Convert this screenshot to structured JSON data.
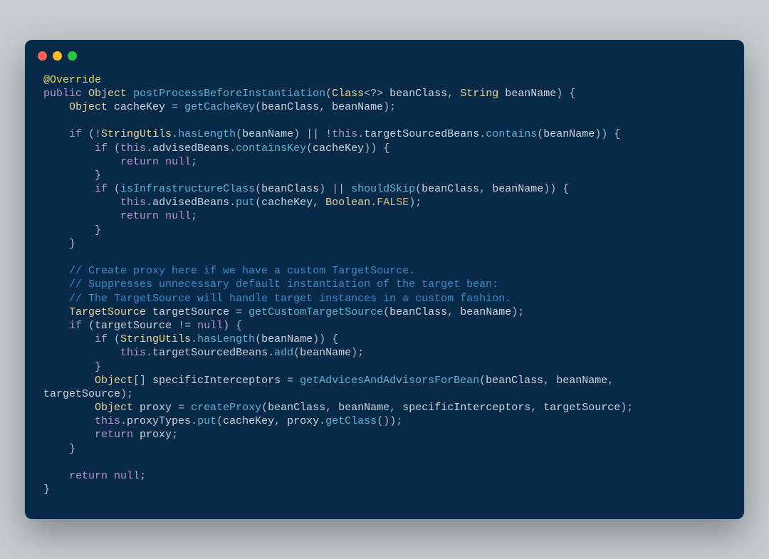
{
  "window": {
    "traffic": {
      "red": "#ff5f56",
      "yellow": "#ffbd2e",
      "green": "#27c93f"
    }
  },
  "code": {
    "lines": [
      [
        {
          "c": "annot",
          "t": "@Override"
        }
      ],
      [
        {
          "c": "keyword",
          "t": "public"
        },
        {
          "c": "punct",
          "t": " "
        },
        {
          "c": "type",
          "t": "Object"
        },
        {
          "c": "punct",
          "t": " "
        },
        {
          "c": "method",
          "t": "postProcessBeforeInstantiation"
        },
        {
          "c": "punct",
          "t": "("
        },
        {
          "c": "type",
          "t": "Class"
        },
        {
          "c": "punct",
          "t": "<?> "
        },
        {
          "c": "ident",
          "t": "beanClass"
        },
        {
          "c": "punct",
          "t": ", "
        },
        {
          "c": "type",
          "t": "String"
        },
        {
          "c": "punct",
          "t": " "
        },
        {
          "c": "ident",
          "t": "beanName"
        },
        {
          "c": "punct",
          "t": ") {"
        }
      ],
      [
        {
          "c": "punct",
          "t": "    "
        },
        {
          "c": "type",
          "t": "Object"
        },
        {
          "c": "punct",
          "t": " "
        },
        {
          "c": "ident",
          "t": "cacheKey"
        },
        {
          "c": "punct",
          "t": " = "
        },
        {
          "c": "method",
          "t": "getCacheKey"
        },
        {
          "c": "punct",
          "t": "("
        },
        {
          "c": "ident",
          "t": "beanClass"
        },
        {
          "c": "punct",
          "t": ", "
        },
        {
          "c": "ident",
          "t": "beanName"
        },
        {
          "c": "punct",
          "t": ");"
        }
      ],
      [
        {
          "c": "punct",
          "t": ""
        }
      ],
      [
        {
          "c": "punct",
          "t": "    "
        },
        {
          "c": "keyword",
          "t": "if"
        },
        {
          "c": "punct",
          "t": " (!"
        },
        {
          "c": "type",
          "t": "StringUtils"
        },
        {
          "c": "punct",
          "t": "."
        },
        {
          "c": "method",
          "t": "hasLength"
        },
        {
          "c": "punct",
          "t": "("
        },
        {
          "c": "ident",
          "t": "beanName"
        },
        {
          "c": "punct",
          "t": ") || !"
        },
        {
          "c": "kwthis",
          "t": "this"
        },
        {
          "c": "punct",
          "t": "."
        },
        {
          "c": "ident",
          "t": "targetSourcedBeans"
        },
        {
          "c": "punct",
          "t": "."
        },
        {
          "c": "method",
          "t": "contains"
        },
        {
          "c": "punct",
          "t": "("
        },
        {
          "c": "ident",
          "t": "beanName"
        },
        {
          "c": "punct",
          "t": ")) {"
        }
      ],
      [
        {
          "c": "punct",
          "t": "        "
        },
        {
          "c": "keyword",
          "t": "if"
        },
        {
          "c": "punct",
          "t": " ("
        },
        {
          "c": "kwthis",
          "t": "this"
        },
        {
          "c": "punct",
          "t": "."
        },
        {
          "c": "ident",
          "t": "advisedBeans"
        },
        {
          "c": "punct",
          "t": "."
        },
        {
          "c": "method",
          "t": "containsKey"
        },
        {
          "c": "punct",
          "t": "("
        },
        {
          "c": "ident",
          "t": "cacheKey"
        },
        {
          "c": "punct",
          "t": ")) {"
        }
      ],
      [
        {
          "c": "punct",
          "t": "            "
        },
        {
          "c": "keyword",
          "t": "return"
        },
        {
          "c": "punct",
          "t": " "
        },
        {
          "c": "null",
          "t": "null"
        },
        {
          "c": "punct",
          "t": ";"
        }
      ],
      [
        {
          "c": "punct",
          "t": "        }"
        }
      ],
      [
        {
          "c": "punct",
          "t": "        "
        },
        {
          "c": "keyword",
          "t": "if"
        },
        {
          "c": "punct",
          "t": " ("
        },
        {
          "c": "method",
          "t": "isInfrastructureClass"
        },
        {
          "c": "punct",
          "t": "("
        },
        {
          "c": "ident",
          "t": "beanClass"
        },
        {
          "c": "punct",
          "t": ") || "
        },
        {
          "c": "method",
          "t": "shouldSkip"
        },
        {
          "c": "punct",
          "t": "("
        },
        {
          "c": "ident",
          "t": "beanClass"
        },
        {
          "c": "punct",
          "t": ", "
        },
        {
          "c": "ident",
          "t": "beanName"
        },
        {
          "c": "punct",
          "t": ")) {"
        }
      ],
      [
        {
          "c": "punct",
          "t": "            "
        },
        {
          "c": "kwthis",
          "t": "this"
        },
        {
          "c": "punct",
          "t": "."
        },
        {
          "c": "ident",
          "t": "advisedBeans"
        },
        {
          "c": "punct",
          "t": "."
        },
        {
          "c": "method",
          "t": "put"
        },
        {
          "c": "punct",
          "t": "("
        },
        {
          "c": "ident",
          "t": "cacheKey"
        },
        {
          "c": "punct",
          "t": ", "
        },
        {
          "c": "type",
          "t": "Boolean"
        },
        {
          "c": "punct",
          "t": "."
        },
        {
          "c": "const",
          "t": "FALSE"
        },
        {
          "c": "punct",
          "t": ");"
        }
      ],
      [
        {
          "c": "punct",
          "t": "            "
        },
        {
          "c": "keyword",
          "t": "return"
        },
        {
          "c": "punct",
          "t": " "
        },
        {
          "c": "null",
          "t": "null"
        },
        {
          "c": "punct",
          "t": ";"
        }
      ],
      [
        {
          "c": "punct",
          "t": "        }"
        }
      ],
      [
        {
          "c": "punct",
          "t": "    }"
        }
      ],
      [
        {
          "c": "punct",
          "t": ""
        }
      ],
      [
        {
          "c": "punct",
          "t": "    "
        },
        {
          "c": "comment",
          "t": "// Create proxy here if we have a custom TargetSource."
        }
      ],
      [
        {
          "c": "punct",
          "t": "    "
        },
        {
          "c": "comment",
          "t": "// Suppresses unnecessary default instantiation of the target bean:"
        }
      ],
      [
        {
          "c": "punct",
          "t": "    "
        },
        {
          "c": "comment",
          "t": "// The TargetSource will handle target instances in a custom fashion."
        }
      ],
      [
        {
          "c": "punct",
          "t": "    "
        },
        {
          "c": "type",
          "t": "TargetSource"
        },
        {
          "c": "punct",
          "t": " "
        },
        {
          "c": "ident",
          "t": "targetSource"
        },
        {
          "c": "punct",
          "t": " = "
        },
        {
          "c": "method",
          "t": "getCustomTargetSource"
        },
        {
          "c": "punct",
          "t": "("
        },
        {
          "c": "ident",
          "t": "beanClass"
        },
        {
          "c": "punct",
          "t": ", "
        },
        {
          "c": "ident",
          "t": "beanName"
        },
        {
          "c": "punct",
          "t": ");"
        }
      ],
      [
        {
          "c": "punct",
          "t": "    "
        },
        {
          "c": "keyword",
          "t": "if"
        },
        {
          "c": "punct",
          "t": " ("
        },
        {
          "c": "ident",
          "t": "targetSource"
        },
        {
          "c": "punct",
          "t": " != "
        },
        {
          "c": "null",
          "t": "null"
        },
        {
          "c": "punct",
          "t": ") {"
        }
      ],
      [
        {
          "c": "punct",
          "t": "        "
        },
        {
          "c": "keyword",
          "t": "if"
        },
        {
          "c": "punct",
          "t": " ("
        },
        {
          "c": "type",
          "t": "StringUtils"
        },
        {
          "c": "punct",
          "t": "."
        },
        {
          "c": "method",
          "t": "hasLength"
        },
        {
          "c": "punct",
          "t": "("
        },
        {
          "c": "ident",
          "t": "beanName"
        },
        {
          "c": "punct",
          "t": ")) {"
        }
      ],
      [
        {
          "c": "punct",
          "t": "            "
        },
        {
          "c": "kwthis",
          "t": "this"
        },
        {
          "c": "punct",
          "t": "."
        },
        {
          "c": "ident",
          "t": "targetSourcedBeans"
        },
        {
          "c": "punct",
          "t": "."
        },
        {
          "c": "method",
          "t": "add"
        },
        {
          "c": "punct",
          "t": "("
        },
        {
          "c": "ident",
          "t": "beanName"
        },
        {
          "c": "punct",
          "t": ");"
        }
      ],
      [
        {
          "c": "punct",
          "t": "        }"
        }
      ],
      [
        {
          "c": "punct",
          "t": "        "
        },
        {
          "c": "type",
          "t": "Object"
        },
        {
          "c": "punct",
          "t": "[] "
        },
        {
          "c": "ident",
          "t": "specificInterceptors"
        },
        {
          "c": "punct",
          "t": " = "
        },
        {
          "c": "method",
          "t": "getAdvicesAndAdvisorsForBean"
        },
        {
          "c": "punct",
          "t": "("
        },
        {
          "c": "ident",
          "t": "beanClass"
        },
        {
          "c": "punct",
          "t": ", "
        },
        {
          "c": "ident",
          "t": "beanName"
        },
        {
          "c": "punct",
          "t": ", "
        }
      ],
      [
        {
          "c": "ident",
          "t": "targetSource"
        },
        {
          "c": "punct",
          "t": ");"
        }
      ],
      [
        {
          "c": "punct",
          "t": "        "
        },
        {
          "c": "type",
          "t": "Object"
        },
        {
          "c": "punct",
          "t": " "
        },
        {
          "c": "ident",
          "t": "proxy"
        },
        {
          "c": "punct",
          "t": " = "
        },
        {
          "c": "method",
          "t": "createProxy"
        },
        {
          "c": "punct",
          "t": "("
        },
        {
          "c": "ident",
          "t": "beanClass"
        },
        {
          "c": "punct",
          "t": ", "
        },
        {
          "c": "ident",
          "t": "beanName"
        },
        {
          "c": "punct",
          "t": ", "
        },
        {
          "c": "ident",
          "t": "specificInterceptors"
        },
        {
          "c": "punct",
          "t": ", "
        },
        {
          "c": "ident",
          "t": "targetSource"
        },
        {
          "c": "punct",
          "t": ");"
        }
      ],
      [
        {
          "c": "punct",
          "t": "        "
        },
        {
          "c": "kwthis",
          "t": "this"
        },
        {
          "c": "punct",
          "t": "."
        },
        {
          "c": "ident",
          "t": "proxyTypes"
        },
        {
          "c": "punct",
          "t": "."
        },
        {
          "c": "method",
          "t": "put"
        },
        {
          "c": "punct",
          "t": "("
        },
        {
          "c": "ident",
          "t": "cacheKey"
        },
        {
          "c": "punct",
          "t": ", "
        },
        {
          "c": "ident",
          "t": "proxy"
        },
        {
          "c": "punct",
          "t": "."
        },
        {
          "c": "method",
          "t": "getClass"
        },
        {
          "c": "punct",
          "t": "());"
        }
      ],
      [
        {
          "c": "punct",
          "t": "        "
        },
        {
          "c": "keyword",
          "t": "return"
        },
        {
          "c": "punct",
          "t": " "
        },
        {
          "c": "ident",
          "t": "proxy"
        },
        {
          "c": "punct",
          "t": ";"
        }
      ],
      [
        {
          "c": "punct",
          "t": "    }"
        }
      ],
      [
        {
          "c": "punct",
          "t": ""
        }
      ],
      [
        {
          "c": "punct",
          "t": "    "
        },
        {
          "c": "keyword",
          "t": "return"
        },
        {
          "c": "punct",
          "t": " "
        },
        {
          "c": "null",
          "t": "null"
        },
        {
          "c": "punct",
          "t": ";"
        }
      ],
      [
        {
          "c": "punct",
          "t": "}"
        }
      ]
    ]
  }
}
